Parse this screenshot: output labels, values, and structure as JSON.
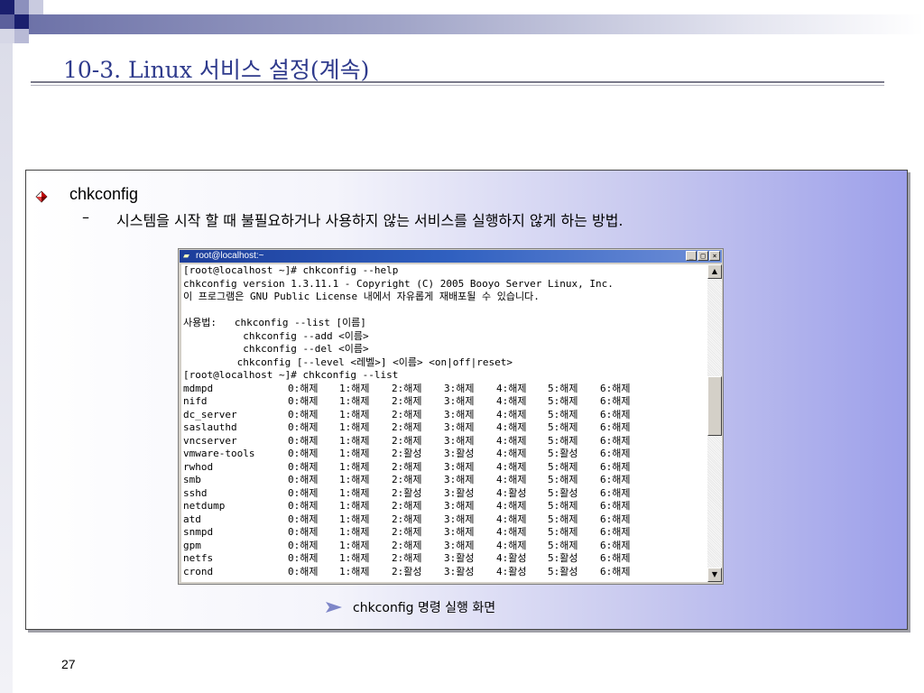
{
  "slide": {
    "title": "10-3. Linux 서비스 설정(계속)",
    "page_number": "27",
    "bullet1": "chkconfig",
    "dash": "–",
    "bullet2": "시스템을 시작 할 때 불필요하거나 사용하지 않는 서비스를 실행하지 않게 하는 방법.",
    "caption": "chkconfig 명령 실행 화면",
    "accent_color": "#2e3a8c",
    "bullet_color": "#c00000"
  },
  "window": {
    "title": "root@localhost:~",
    "minimize": "_",
    "maximize": "□",
    "close": "×",
    "scroll_up": "▲",
    "scroll_down": "▼"
  },
  "terminal": {
    "lines": [
      "[root@localhost ~]# chkconfig --help",
      "chkconfig version 1.3.11.1 - Copyright (C) 2005 Booyo Server Linux, Inc.",
      "이 프로그램은 GNU Public License 내에서 자유롭게 재배포될 수 있습니다.",
      "",
      "사용법:   chkconfig --list [이름]",
      "          chkconfig --add <이름>",
      "          chkconfig --del <이름>",
      "         chkconfig [--level <레벨>] <이름> <on|off|reset>",
      "[root@localhost ~]# chkconfig --list"
    ],
    "services": [
      {
        "name": "mdmpd",
        "levels": [
          "0:해제",
          "1:해제",
          "2:해제",
          "3:해제",
          "4:해제",
          "5:해제",
          "6:해제"
        ]
      },
      {
        "name": "nifd",
        "levels": [
          "0:해제",
          "1:해제",
          "2:해제",
          "3:해제",
          "4:해제",
          "5:해제",
          "6:해제"
        ]
      },
      {
        "name": "dc_server",
        "levels": [
          "0:해제",
          "1:해제",
          "2:해제",
          "3:해제",
          "4:해제",
          "5:해제",
          "6:해제"
        ]
      },
      {
        "name": "saslauthd",
        "levels": [
          "0:해제",
          "1:해제",
          "2:해제",
          "3:해제",
          "4:해제",
          "5:해제",
          "6:해제"
        ]
      },
      {
        "name": "vncserver",
        "levels": [
          "0:해제",
          "1:해제",
          "2:해제",
          "3:해제",
          "4:해제",
          "5:해제",
          "6:해제"
        ]
      },
      {
        "name": "vmware-tools",
        "levels": [
          "0:해제",
          "1:해제",
          "2:활성",
          "3:활성",
          "4:해제",
          "5:활성",
          "6:해제"
        ]
      },
      {
        "name": "rwhod",
        "levels": [
          "0:해제",
          "1:해제",
          "2:해제",
          "3:해제",
          "4:해제",
          "5:해제",
          "6:해제"
        ]
      },
      {
        "name": "smb",
        "levels": [
          "0:해제",
          "1:해제",
          "2:해제",
          "3:해제",
          "4:해제",
          "5:해제",
          "6:해제"
        ]
      },
      {
        "name": "sshd",
        "levels": [
          "0:해제",
          "1:해제",
          "2:활성",
          "3:활성",
          "4:활성",
          "5:활성",
          "6:해제"
        ]
      },
      {
        "name": "netdump",
        "levels": [
          "0:해제",
          "1:해제",
          "2:해제",
          "3:해제",
          "4:해제",
          "5:해제",
          "6:해제"
        ]
      },
      {
        "name": "atd",
        "levels": [
          "0:해제",
          "1:해제",
          "2:해제",
          "3:해제",
          "4:해제",
          "5:해제",
          "6:해제"
        ]
      },
      {
        "name": "snmpd",
        "levels": [
          "0:해제",
          "1:해제",
          "2:해제",
          "3:해제",
          "4:해제",
          "5:해제",
          "6:해제"
        ]
      },
      {
        "name": "gpm",
        "levels": [
          "0:해제",
          "1:해제",
          "2:해제",
          "3:해제",
          "4:해제",
          "5:해제",
          "6:해제"
        ]
      },
      {
        "name": "netfs",
        "levels": [
          "0:해제",
          "1:해제",
          "2:해제",
          "3:활성",
          "4:활성",
          "5:활성",
          "6:해제"
        ]
      },
      {
        "name": "crond",
        "levels": [
          "0:해제",
          "1:해제",
          "2:활성",
          "3:활성",
          "4:활성",
          "5:활성",
          "6:해제"
        ]
      }
    ]
  }
}
